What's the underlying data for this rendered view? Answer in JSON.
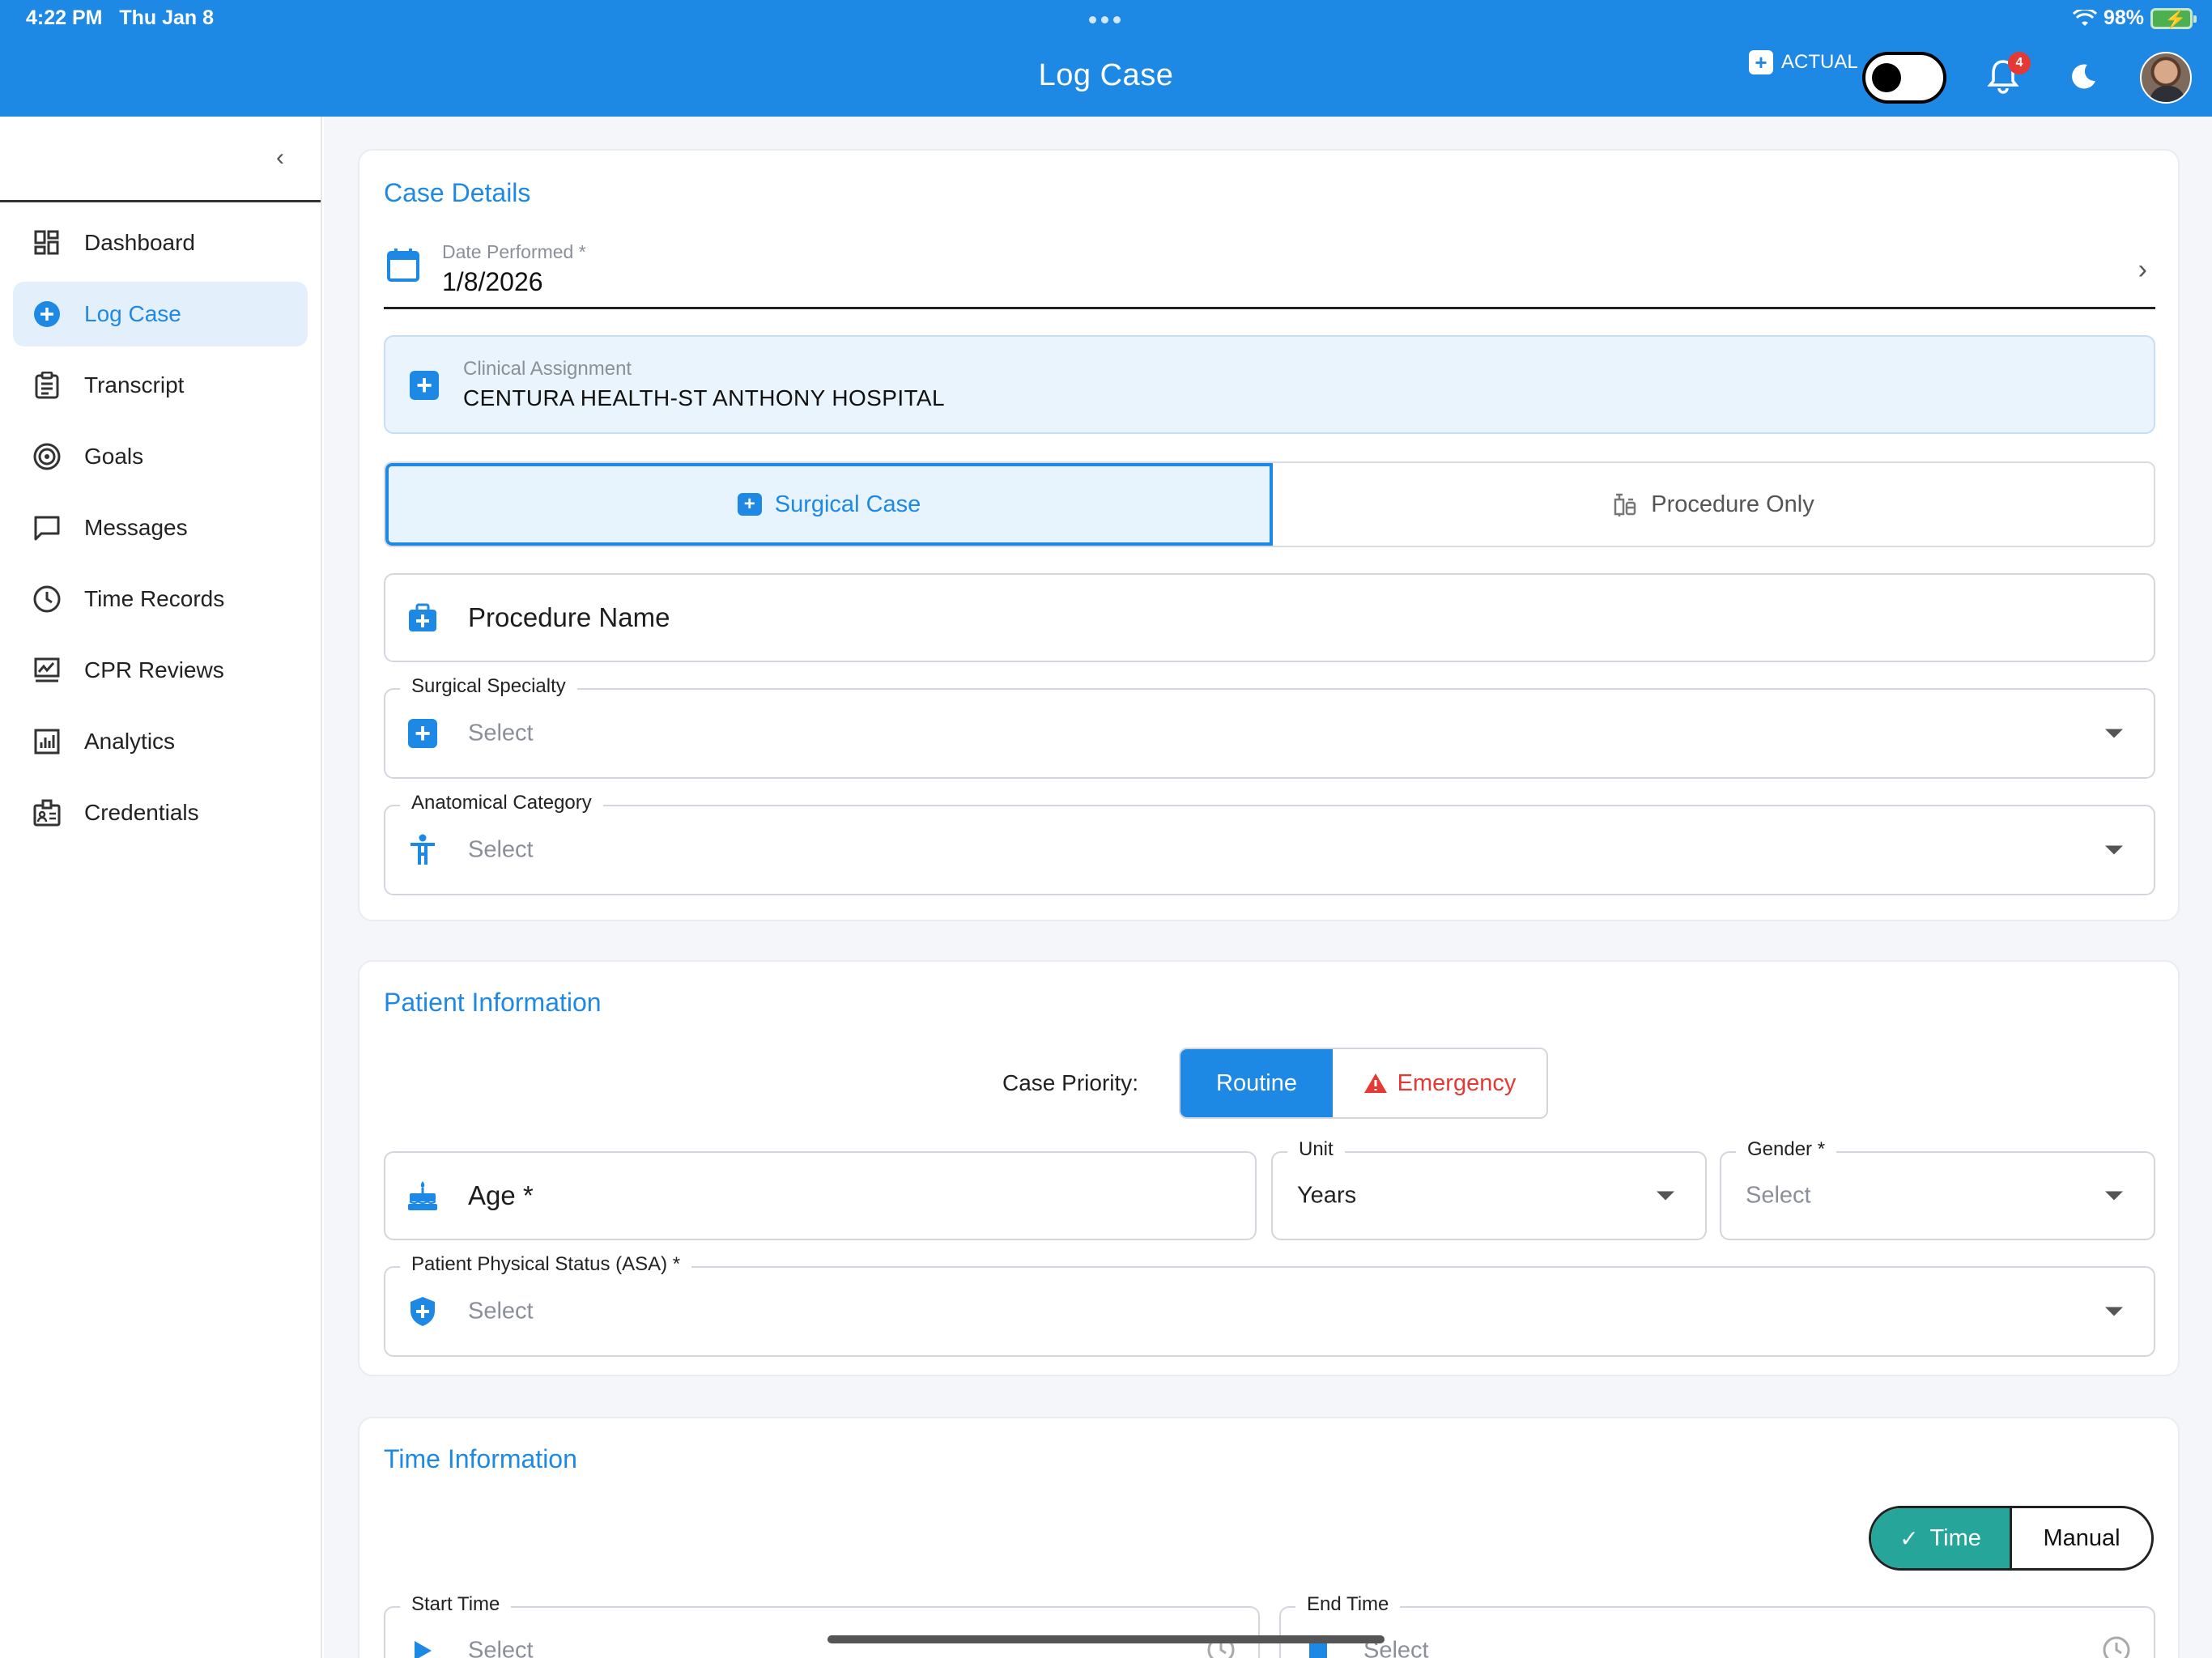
{
  "status_bar": {
    "time": "4:22 PM",
    "date": "Thu Jan 8",
    "battery": "98%"
  },
  "header": {
    "title": "Log Case",
    "mode_label": "ACTUAL",
    "notification_count": "4"
  },
  "sidebar": {
    "items": [
      {
        "label": "Dashboard",
        "icon": "dashboard-icon"
      },
      {
        "label": "Log Case",
        "icon": "add-circle-icon"
      },
      {
        "label": "Transcript",
        "icon": "clipboard-icon"
      },
      {
        "label": "Goals",
        "icon": "target-icon"
      },
      {
        "label": "Messages",
        "icon": "message-icon"
      },
      {
        "label": "Time Records",
        "icon": "clock-icon"
      },
      {
        "label": "CPR Reviews",
        "icon": "signature-icon"
      },
      {
        "label": "Analytics",
        "icon": "analytics-icon"
      },
      {
        "label": "Credentials",
        "icon": "badge-icon"
      }
    ]
  },
  "case_details": {
    "title": "Case Details",
    "date_label": "Date Performed *",
    "date_value": "1/8/2026",
    "assignment_label": "Clinical Assignment",
    "assignment_value": "CENTURA HEALTH-ST ANTHONY HOSPITAL",
    "surgical_case": "Surgical Case",
    "procedure_only": "Procedure Only",
    "procedure_name": "Procedure Name",
    "specialty_label": "Surgical Specialty",
    "specialty_value": "Select",
    "anatomical_label": "Anatomical Category",
    "anatomical_value": "Select"
  },
  "patient_info": {
    "title": "Patient Information",
    "priority_label": "Case Priority:",
    "routine": "Routine",
    "emergency": "Emergency",
    "age_label": "Age *",
    "unit_label": "Unit",
    "unit_value": "Years",
    "gender_label": "Gender *",
    "gender_value": "Select",
    "asa_label": "Patient Physical Status (ASA) *",
    "asa_value": "Select"
  },
  "time_info": {
    "title": "Time Information",
    "time_btn": "Time",
    "manual_btn": "Manual",
    "start_label": "Start Time",
    "start_value": "Select",
    "end_label": "End Time",
    "end_value": "Select"
  },
  "colors": {
    "primary": "#1E88E5",
    "teal": "#26A69A",
    "danger": "#E53935"
  }
}
